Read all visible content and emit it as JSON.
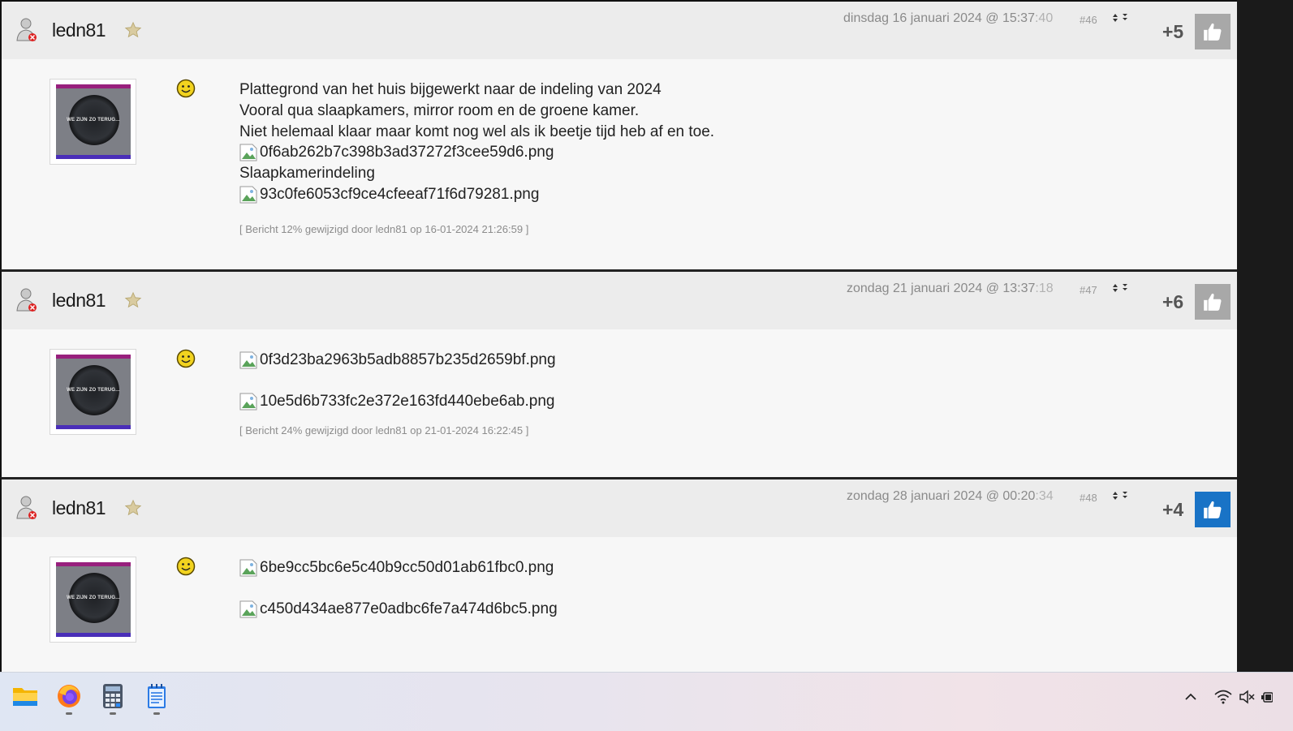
{
  "posts": [
    {
      "username": "ledn81",
      "date": "dinsdag 16 januari 2024 @ 15:37",
      "seconds": ":40",
      "number": "#46",
      "score": "+5",
      "liked": false,
      "lines": [
        "Plattegrond van het huis bijgewerkt naar de indeling van 2024",
        "Vooral qua slaapkamers, mirror room en de groene kamer.",
        "Niet helemaal klaar maar komt nog wel als ik beetje tijd heb af en toe."
      ],
      "image1": "0f6ab262b7c398b3ad37272f3cee59d6.png",
      "caption": "Slaapkamerindeling",
      "image2": "93c0fe6053cf9ce4cfeeaf71f6d79281.png",
      "edit_note": "[ Bericht 12% gewijzigd door ledn81 op 16-01-2024 21:26:59 ]"
    },
    {
      "username": "ledn81",
      "date": "zondag 21 januari 2024 @ 13:37",
      "seconds": ":18",
      "number": "#47",
      "score": "+6",
      "liked": false,
      "image1": "0f3d23ba2963b5adb8857b235d2659bf.png",
      "image2": "10e5d6b733fc2e372e163fd440ebe6ab.png",
      "edit_note": "[ Bericht 24% gewijzigd door ledn81 op 21-01-2024 16:22:45 ]"
    },
    {
      "username": "ledn81",
      "date": "zondag 28 januari 2024 @ 00:20",
      "seconds": ":34",
      "number": "#48",
      "score": "+4",
      "liked": true,
      "image1": "6be9cc5bc6e5c40b9cc50d01ab61fbc0.png",
      "image2": "c450d434ae877e0adbc6fe7a474d6bc5.png"
    }
  ],
  "avatar_text": "WE ZIJN ZO TERUG...",
  "colors": {
    "like_active": "#1973c6",
    "like_inactive": "#a8a8a8",
    "header_bg": "#ececec",
    "body_bg": "#f7f7f7"
  },
  "taskbar": {
    "apps": [
      "file-explorer-icon",
      "firefox-icon",
      "calculator-icon",
      "notepad-icon"
    ],
    "tray": [
      "chevron-up-icon",
      "wifi-icon",
      "volume-muted-icon",
      "battery-icon"
    ]
  }
}
